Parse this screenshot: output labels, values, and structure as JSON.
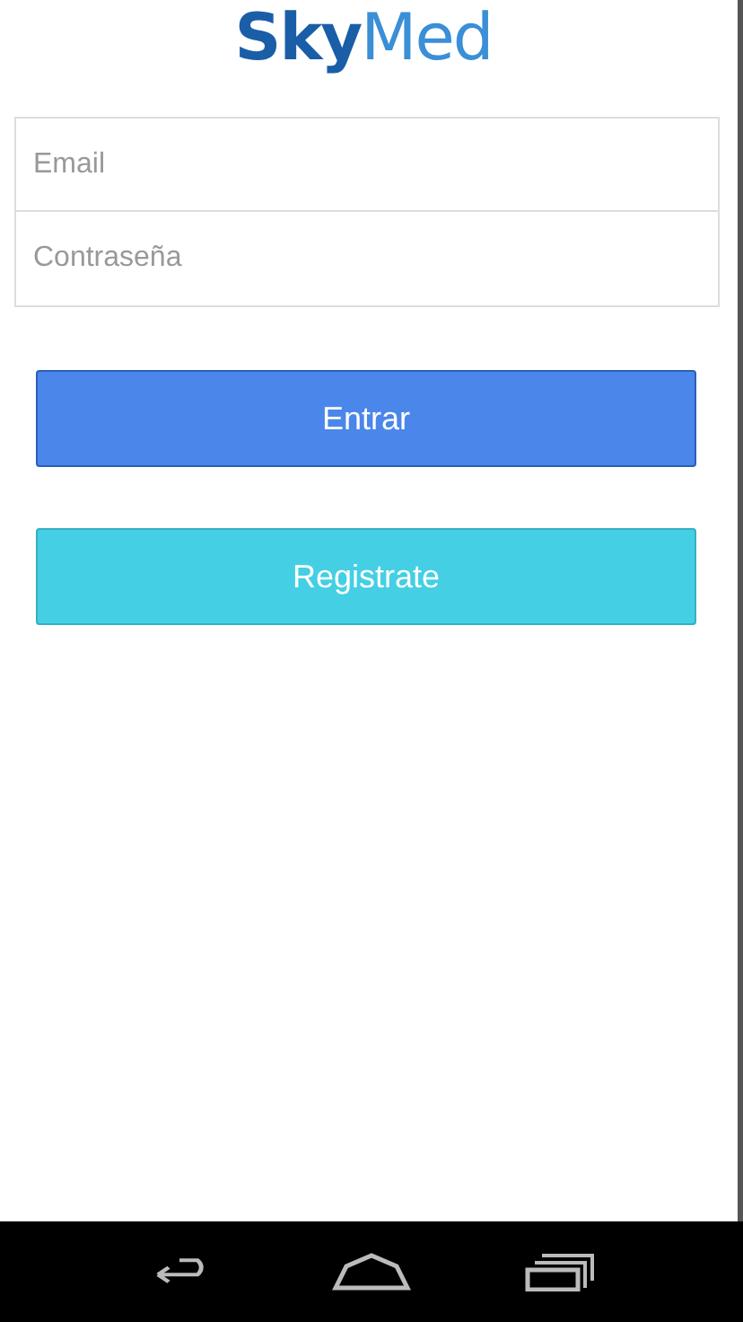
{
  "logo": {
    "text": "**Sky**Med"
  },
  "fields": [
    {
      "placeholder": "Email"
    },
    {
      "placeholder": "Contraseña"
    }
  ],
  "buttons": [
    {
      "label": "Entrar",
      "kind": "primary"
    },
    {
      "label": "Registrate",
      "kind": "secondary"
    }
  ]
}
